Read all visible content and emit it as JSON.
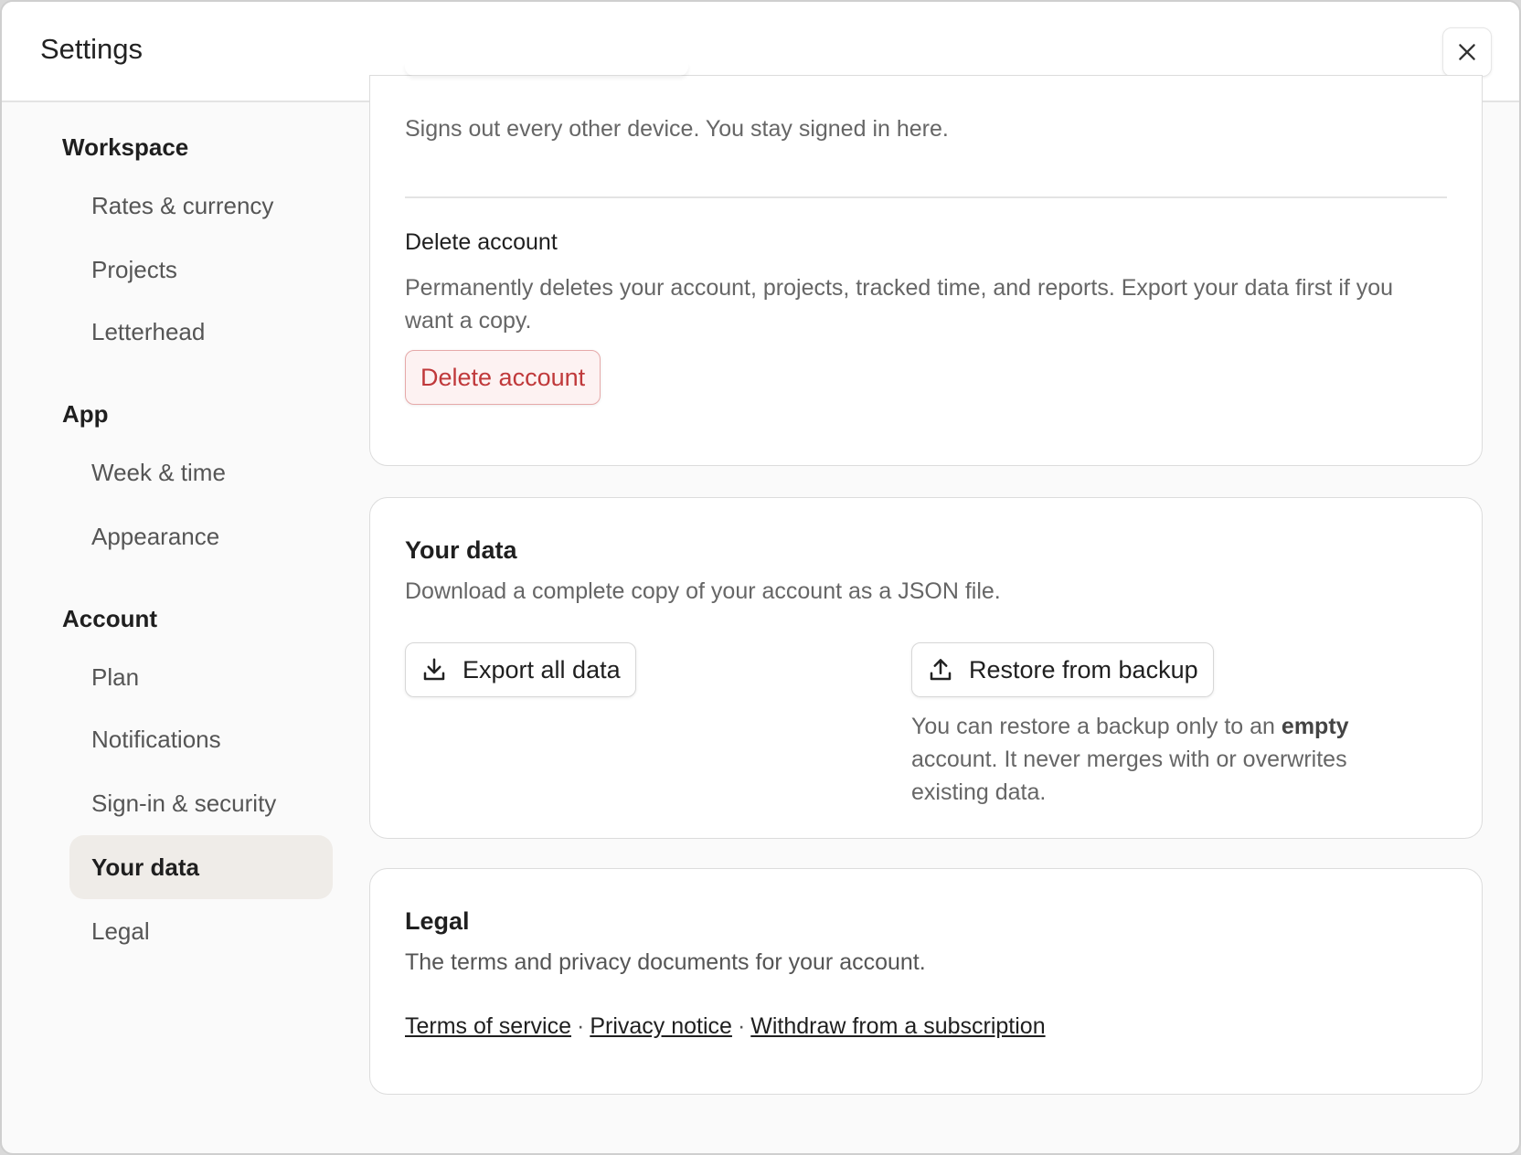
{
  "header": {
    "title": "Settings",
    "close_icon": "close-icon"
  },
  "sidebar": {
    "groups": [
      {
        "label": "Workspace",
        "items": [
          {
            "label": "Rates & currency"
          },
          {
            "label": "Projects"
          },
          {
            "label": "Letterhead"
          }
        ]
      },
      {
        "label": "App",
        "items": [
          {
            "label": "Week & time"
          },
          {
            "label": "Appearance"
          }
        ]
      },
      {
        "label": "Account",
        "items": [
          {
            "label": "Plan"
          },
          {
            "label": "Notifications"
          },
          {
            "label": "Sign-in & security"
          },
          {
            "label": "Your data",
            "active": true
          },
          {
            "label": "Legal"
          }
        ]
      }
    ]
  },
  "security": {
    "sign_out_hint": "Signs out every other device. You stay signed in here.",
    "delete_title": "Delete account",
    "delete_desc": "Permanently deletes your account, projects, tracked time, and reports. Export your data first if you want a copy.",
    "delete_button": "Delete account"
  },
  "your_data": {
    "title": "Your data",
    "desc": "Download a complete copy of your account as a JSON file.",
    "export_button": "Export all data",
    "export_icon": "download-icon",
    "restore_button": "Restore from backup",
    "restore_icon": "upload-icon",
    "restore_note_pre": "You can restore a backup only to an ",
    "restore_note_bold": "empty",
    "restore_note_post": " account. It never merges with or overwrites existing data."
  },
  "legal": {
    "title": "Legal",
    "desc": "The terms and privacy documents for your account.",
    "links": [
      "Terms of service",
      "Privacy notice",
      "Withdraw from a subscription"
    ],
    "separator": "·"
  },
  "colors": {
    "danger": "#c0393b",
    "active_nav_bg": "#efece8"
  }
}
